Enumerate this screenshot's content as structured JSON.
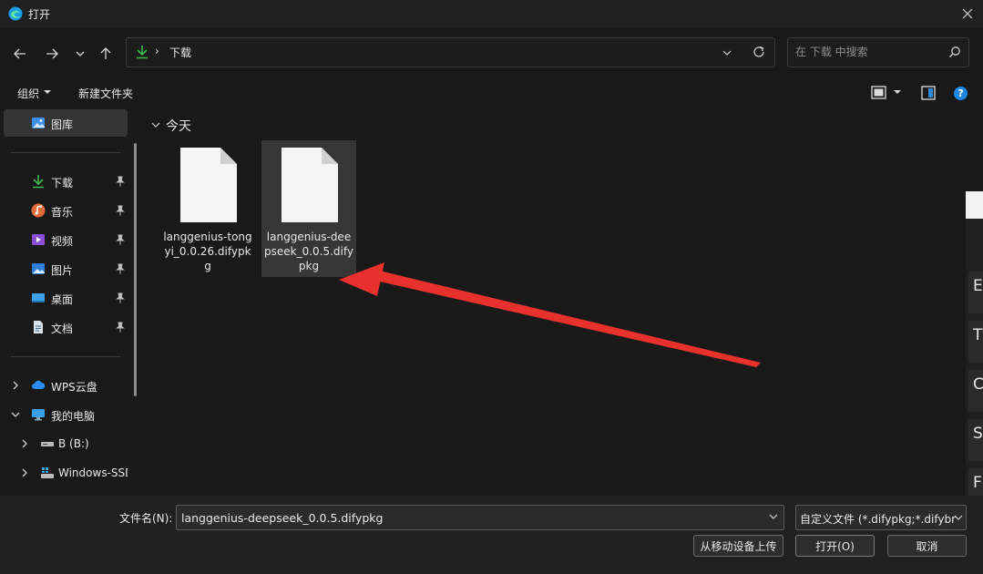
{
  "window": {
    "title": "打开"
  },
  "address": {
    "current_folder": "下载",
    "separator": "›"
  },
  "search": {
    "placeholder": "在 下载 中搜索"
  },
  "toolbar": {
    "organize_label": "组织",
    "new_folder_label": "新建文件夹",
    "help_label": "?"
  },
  "sidebar": {
    "items": [
      {
        "label": "图库",
        "icon": "gallery-icon",
        "selected": true
      },
      {
        "label": "下载",
        "icon": "download-icon",
        "pinned": true
      },
      {
        "label": "音乐",
        "icon": "music-icon",
        "pinned": true
      },
      {
        "label": "视频",
        "icon": "video-icon",
        "pinned": true
      },
      {
        "label": "图片",
        "icon": "picture-icon",
        "pinned": true
      },
      {
        "label": "桌面",
        "icon": "desktop-icon",
        "pinned": true
      },
      {
        "label": "文档",
        "icon": "document-icon",
        "pinned": true
      },
      {
        "label": "WPS云盘",
        "icon": "cloud-icon",
        "expanded": false
      },
      {
        "label": "我的电脑",
        "icon": "computer-icon",
        "expanded": true
      },
      {
        "label": "B (B:)",
        "icon": "drive-icon",
        "expanded": false
      },
      {
        "label": "Windows-SSD",
        "icon": "windows-drive-icon",
        "expanded": false
      }
    ]
  },
  "main": {
    "section_label": "今天",
    "files": [
      {
        "name": "langgenius-tongyi_0.0.26.difypkg",
        "selected": false
      },
      {
        "name": "langgenius-deepseek_0.0.5.difypkg",
        "selected": true
      }
    ]
  },
  "peek_window": {
    "letters": [
      "E",
      "T",
      "C",
      "S",
      "F"
    ]
  },
  "bottom": {
    "filename_label": "文件名(N):",
    "filename_value": "langgenius-deepseek_0.0.5.difypkg",
    "filetype_value": "自定义文件 (*.difypkg;*.difybr",
    "upload_label": "从移动设备上传",
    "open_label": "打开(O)",
    "cancel_label": "取消"
  },
  "colors": {
    "accent": "#1e88e5",
    "arrow": "#e8302c",
    "download_green": "#3fb950"
  }
}
